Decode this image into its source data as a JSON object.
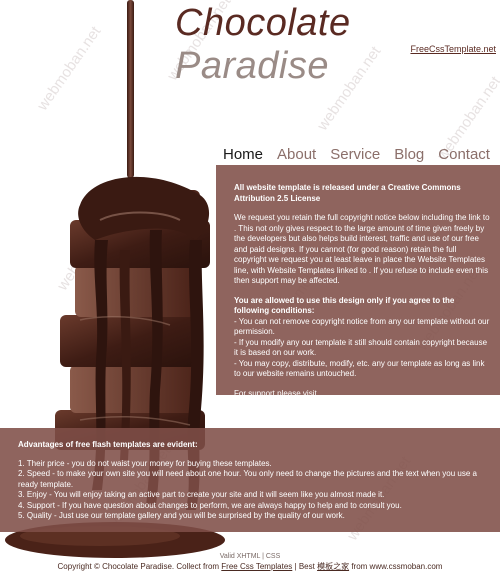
{
  "site": {
    "title_part1": "Chocolate",
    "title_part2": "Paradise",
    "link": "FreeCssTemplate.net"
  },
  "nav": {
    "items": [
      {
        "label": "Home",
        "active": true
      },
      {
        "label": "About",
        "active": false
      },
      {
        "label": "Service",
        "active": false
      },
      {
        "label": "Blog",
        "active": false
      },
      {
        "label": "Contact",
        "active": false
      }
    ]
  },
  "content": {
    "license_heading": "All website template is released under a Creative Commons Attribution 2.5 License",
    "license_body": "We request you retain the full copyright notice below including the link to . This not only gives respect to the large amount of time given freely by the developers but also helps build interest, traffic and use of our free and paid designs. If you cannot (for good reason) retain the full copyright we request you at least leave in place the Website Templates line, with Website Templates linked to . If you refuse to include even this then support may be affected.",
    "allowed_heading": "You are allowed to use this design only if you agree to the following conditions:",
    "conditions": [
      "- You can not remove copyright notice from any our template without our permission.",
      "- If you modify any our template it still should contain copyright because it is based on our work.",
      "- You may copy, distribute, modify, etc. any our template as long as link to our website remains untouched."
    ],
    "support": "For support please visit"
  },
  "advantages": {
    "heading": "Advantages of free flash templates are evident:",
    "items": [
      "1. Their price - you do not waist your money for buying these templates.",
      "2. Speed - to make your own site you will need about one hour. You only need to change the pictures and the text when you use a ready template.",
      "3. Enjoy - You will enjoy taking an active part to create your site and it will seem like you almost made it.",
      "4. Support - If you have question about changes to perform, we are always happy to help and to consult you.",
      "5. Quality - Just use our template gallery and you will be surprised by the quality of our work."
    ]
  },
  "footer": {
    "line1": "Valid XHTML | CSS",
    "copyright": "Copyright © Chocolate Paradise. Collect from",
    "link1": "Free Css Templates",
    "sep": "| Best",
    "link2": "模板之家",
    "from": "from www.cssmoban.com"
  },
  "watermark": "webmoban.net"
}
